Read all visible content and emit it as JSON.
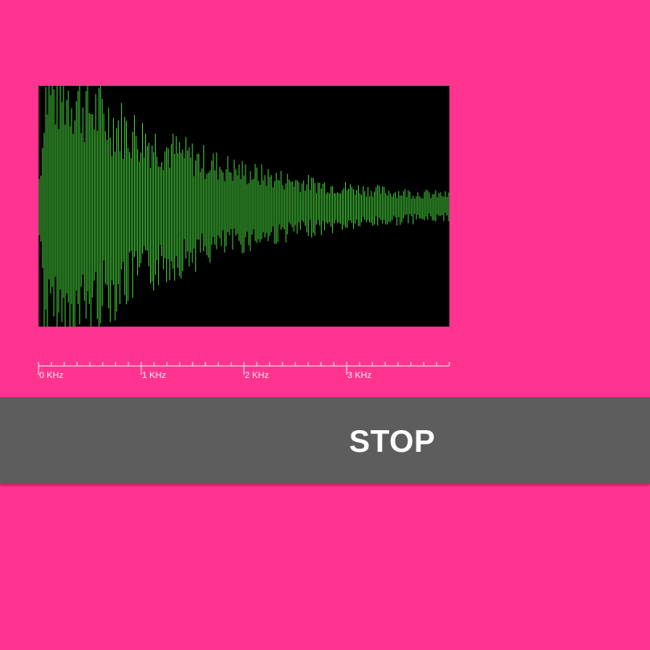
{
  "theme": {
    "background": "#FF3490",
    "display_background": "#000000",
    "waveform_color": "#46D23C",
    "axis_color": "#F4F4F4",
    "button_background": "#5C5D5C",
    "button_text": "#FFFFFF"
  },
  "spectrum": {
    "bar_count": 255,
    "max_amplitude": 1.0,
    "envelope": {
      "start_amplitude": 1.0,
      "end_amplitude": 0.04,
      "decay_rate": 0.012
    }
  },
  "axis": {
    "unit": "KHz",
    "max_khz": 4,
    "major_ticks": [
      {
        "value": 0,
        "label": "0 KHz"
      },
      {
        "value": 1,
        "label": "1 KHz"
      },
      {
        "value": 2,
        "label": "2 KHz"
      },
      {
        "value": 3,
        "label": "3 KHz"
      }
    ],
    "minor_ticks_per_khz": 8
  },
  "controls": {
    "stop_label": "STOP"
  }
}
